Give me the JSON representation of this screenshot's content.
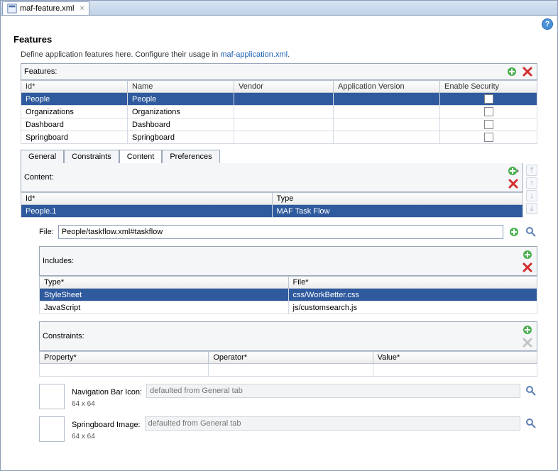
{
  "tab": {
    "title": "maf-feature.xml"
  },
  "page": {
    "title": "Features"
  },
  "intro": {
    "text": "Define application features here. Configure their usage in ",
    "link": "maf-application.xml",
    "suffix": "."
  },
  "features": {
    "heading": "Features:",
    "columns": {
      "id": "Id*",
      "name": "Name",
      "vendor": "Vendor",
      "app_version": "Application Version",
      "enable_security": "Enable Security"
    },
    "rows": [
      {
        "id": "People",
        "name": "People",
        "vendor": "",
        "app_version": ""
      },
      {
        "id": "Organizations",
        "name": "Organizations",
        "vendor": "",
        "app_version": ""
      },
      {
        "id": "Dashboard",
        "name": "Dashboard",
        "vendor": "",
        "app_version": ""
      },
      {
        "id": "Springboard",
        "name": "Springboard",
        "vendor": "",
        "app_version": ""
      }
    ]
  },
  "subtabs": {
    "general": "General",
    "constraints": "Constraints",
    "content": "Content",
    "preferences": "Preferences"
  },
  "contentSection": {
    "heading": "Content:",
    "columns": {
      "id": "Id*",
      "type": "Type"
    },
    "rows": [
      {
        "id": "People.1",
        "type": "MAF Task Flow"
      }
    ]
  },
  "file": {
    "label": "File:",
    "value": "People/taskflow.xml#taskflow"
  },
  "includes": {
    "heading": "Includes:",
    "columns": {
      "type": "Type*",
      "file": "File*"
    },
    "rows": [
      {
        "type": "StyleSheet",
        "file": "css/WorkBetter.css"
      },
      {
        "type": "JavaScript",
        "file": "js/customsearch.js"
      }
    ]
  },
  "constraints_section": {
    "heading": "Constraints:",
    "columns": {
      "property": "Property*",
      "operator": "Operator*",
      "value": "Value*"
    }
  },
  "nav_icon": {
    "label": "Navigation Bar Icon:",
    "placeholder": "defaulted from General tab",
    "dim": "64 x 64"
  },
  "springboard_img": {
    "label": "Springboard Image:",
    "placeholder": "defaulted from General tab",
    "dim": "64 x 64"
  }
}
